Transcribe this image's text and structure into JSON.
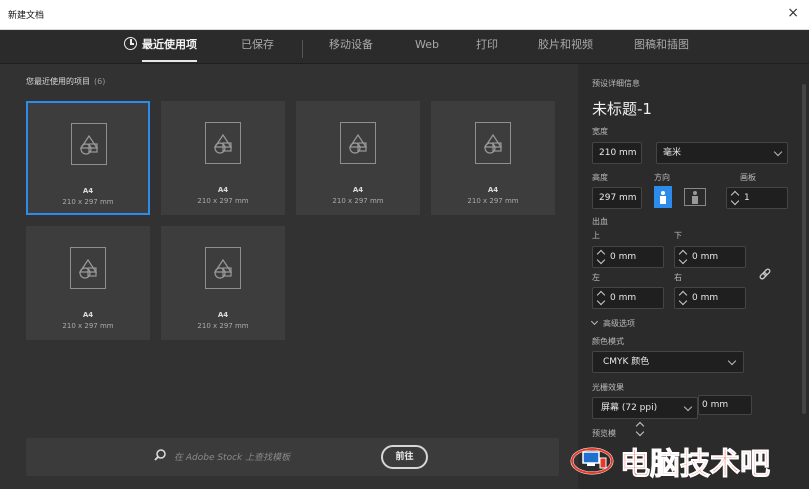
{
  "window": {
    "title": "新建文档",
    "close": "×"
  },
  "tabs": [
    {
      "label": "最近使用项",
      "active": true
    },
    {
      "label": "已保存"
    },
    {
      "label": "移动设备"
    },
    {
      "label": "Web"
    },
    {
      "label": "打印"
    },
    {
      "label": "胶片和视频"
    },
    {
      "label": "图稿和插图"
    }
  ],
  "recent": {
    "heading": "您最近使用的项目",
    "count": "(6)",
    "items": [
      {
        "name": "A4",
        "size": "210 x 297 mm",
        "selected": true
      },
      {
        "name": "A4",
        "size": "210 x 297 mm"
      },
      {
        "name": "A4",
        "size": "210 x 297 mm"
      },
      {
        "name": "A4",
        "size": "210 x 297 mm"
      },
      {
        "name": "A4",
        "size": "210 x 297 mm"
      },
      {
        "name": "A4",
        "size": "210 x 297 mm"
      }
    ]
  },
  "search": {
    "placeholder": "在 Adobe Stock 上查找模板",
    "button": "前往"
  },
  "details": {
    "heading": "预设详细信息",
    "title": "未标题-1",
    "width_label": "宽度",
    "width_value": "210 mm",
    "unit": "毫米",
    "height_label": "高度",
    "height_value": "297 mm",
    "orientation_label": "方向",
    "artboards_label": "画板",
    "artboards_value": "1",
    "bleed_label": "出血",
    "top_label": "上",
    "top_value": "0 mm",
    "bottom_label": "下",
    "bottom_value": "0 mm",
    "left_label": "左",
    "left_value": "0 mm",
    "right_label": "右",
    "right_value": "0 mm",
    "advanced_label": "高级选项",
    "color_mode_label": "颜色模式",
    "color_mode_value": "CMYK 颜色",
    "raster_label": "光栅效果",
    "raster_value": "屏幕 (72 ppi)",
    "raster_offset": "0 mm",
    "preview_label": "预览模"
  },
  "watermark": {
    "text": "电脑技术吧"
  },
  "colors": {
    "accent": "#2d8ceb",
    "watermark": "#e53a2a"
  }
}
